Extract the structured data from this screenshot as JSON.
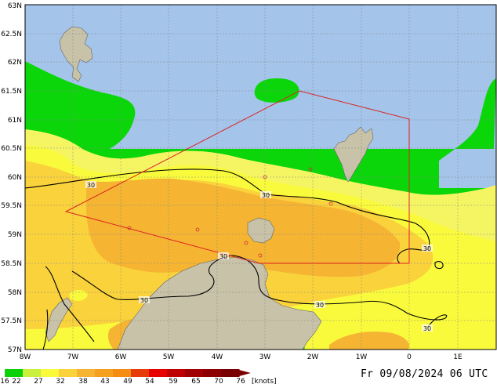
{
  "map": {
    "lat_labels": [
      "63N",
      "62.5N",
      "62N",
      "61.5N",
      "61N",
      "60.5N",
      "60N",
      "59.5N",
      "59N",
      "58.5N",
      "58N",
      "57.5N",
      "57N"
    ],
    "lon_labels": [
      "8W",
      "7W",
      "6W",
      "5W",
      "4W",
      "3W",
      "2W",
      "1W",
      "0",
      "1E"
    ],
    "contour_labels": [
      "30",
      "30",
      "30",
      "30",
      "30",
      "30",
      "30"
    ]
  },
  "legend": {
    "values": [
      "16",
      "22",
      "27",
      "32",
      "38",
      "43",
      "49",
      "54",
      "59",
      "65",
      "70",
      "76"
    ],
    "unit": "[knots]",
    "colors": [
      "#0ad10a",
      "#c8f03c",
      "#fafa3c",
      "#fad23c",
      "#f5b432",
      "#f5a01e",
      "#f58c14",
      "#e63c0a",
      "#e60000",
      "#be0000",
      "#a00000",
      "#8c0000",
      "#780000"
    ]
  },
  "colors": {
    "sea": "#a4c4ea",
    "land": "#c8c2a8",
    "green": "#0ad60a",
    "yellow_light": "#f5f564",
    "yellow": "#fafa3c",
    "orange_light": "#fad23c",
    "orange": "#f5b432",
    "box": "#dd2222"
  },
  "footer": {
    "datetime": "Fr 09/08/2024 06 UTC"
  }
}
